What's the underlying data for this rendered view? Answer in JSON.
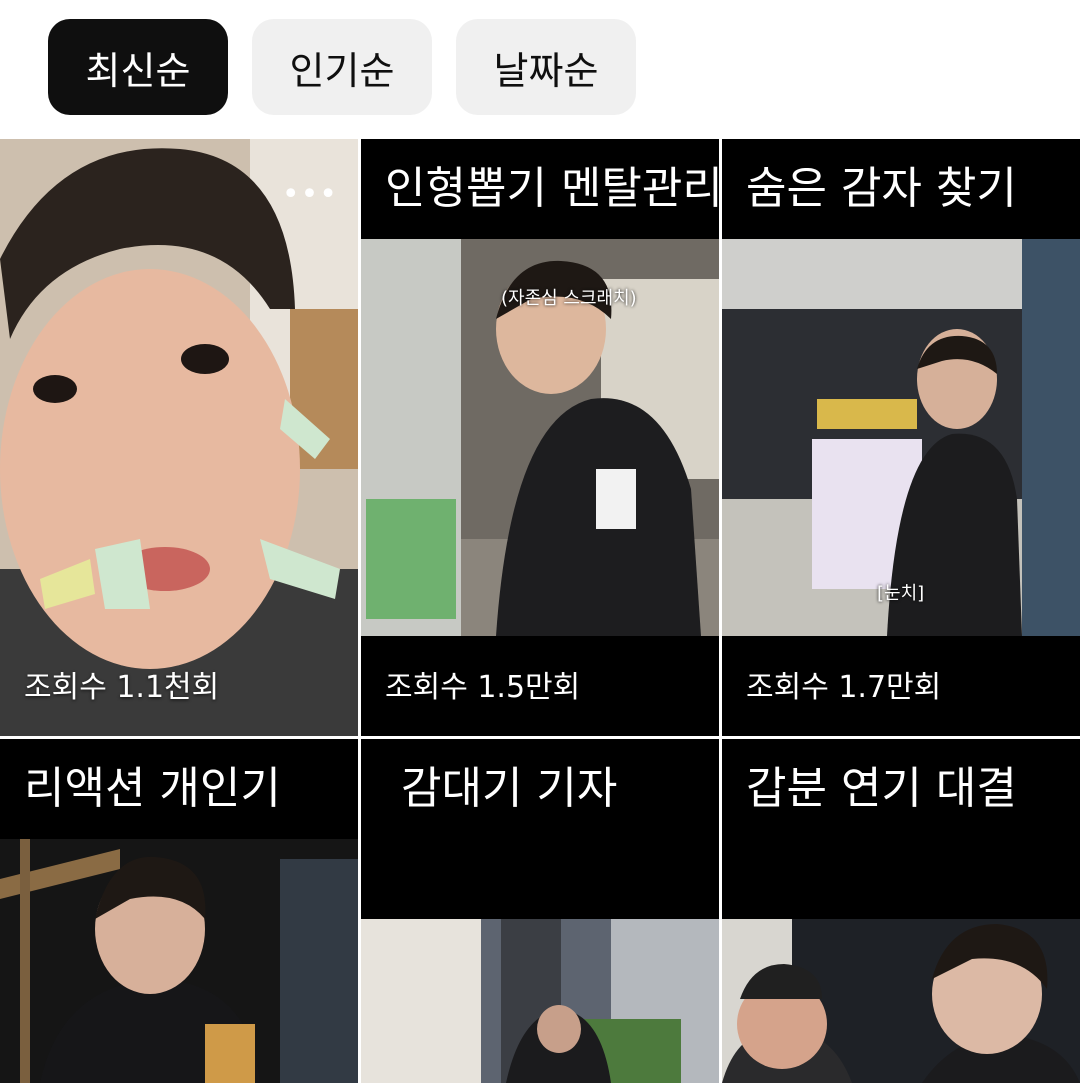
{
  "sort_chips": [
    {
      "label": "최신순",
      "active": true
    },
    {
      "label": "인기순",
      "active": false
    },
    {
      "label": "날짜순",
      "active": false
    }
  ],
  "shorts": [
    {
      "title": "",
      "views": "조회수 1.1천회",
      "menu_icon": "more-dots-icon"
    },
    {
      "title": "인형뽑기 멘탈관리법",
      "views": "조회수 1.5만회",
      "caption": "(자존심 스크래치)"
    },
    {
      "title": "숨은 감자 찾기",
      "views": "조회수 1.7만회",
      "caption": "[눈치]"
    },
    {
      "title": "리액션 개인기",
      "views": ""
    },
    {
      "title": "감대기 기자",
      "views": ""
    },
    {
      "title": "갑분 연기 대결",
      "views": ""
    }
  ],
  "colors": {
    "chip_active_bg": "#0f0f0f",
    "chip_bg": "#f0f0f0",
    "title_bar": "#000000"
  }
}
